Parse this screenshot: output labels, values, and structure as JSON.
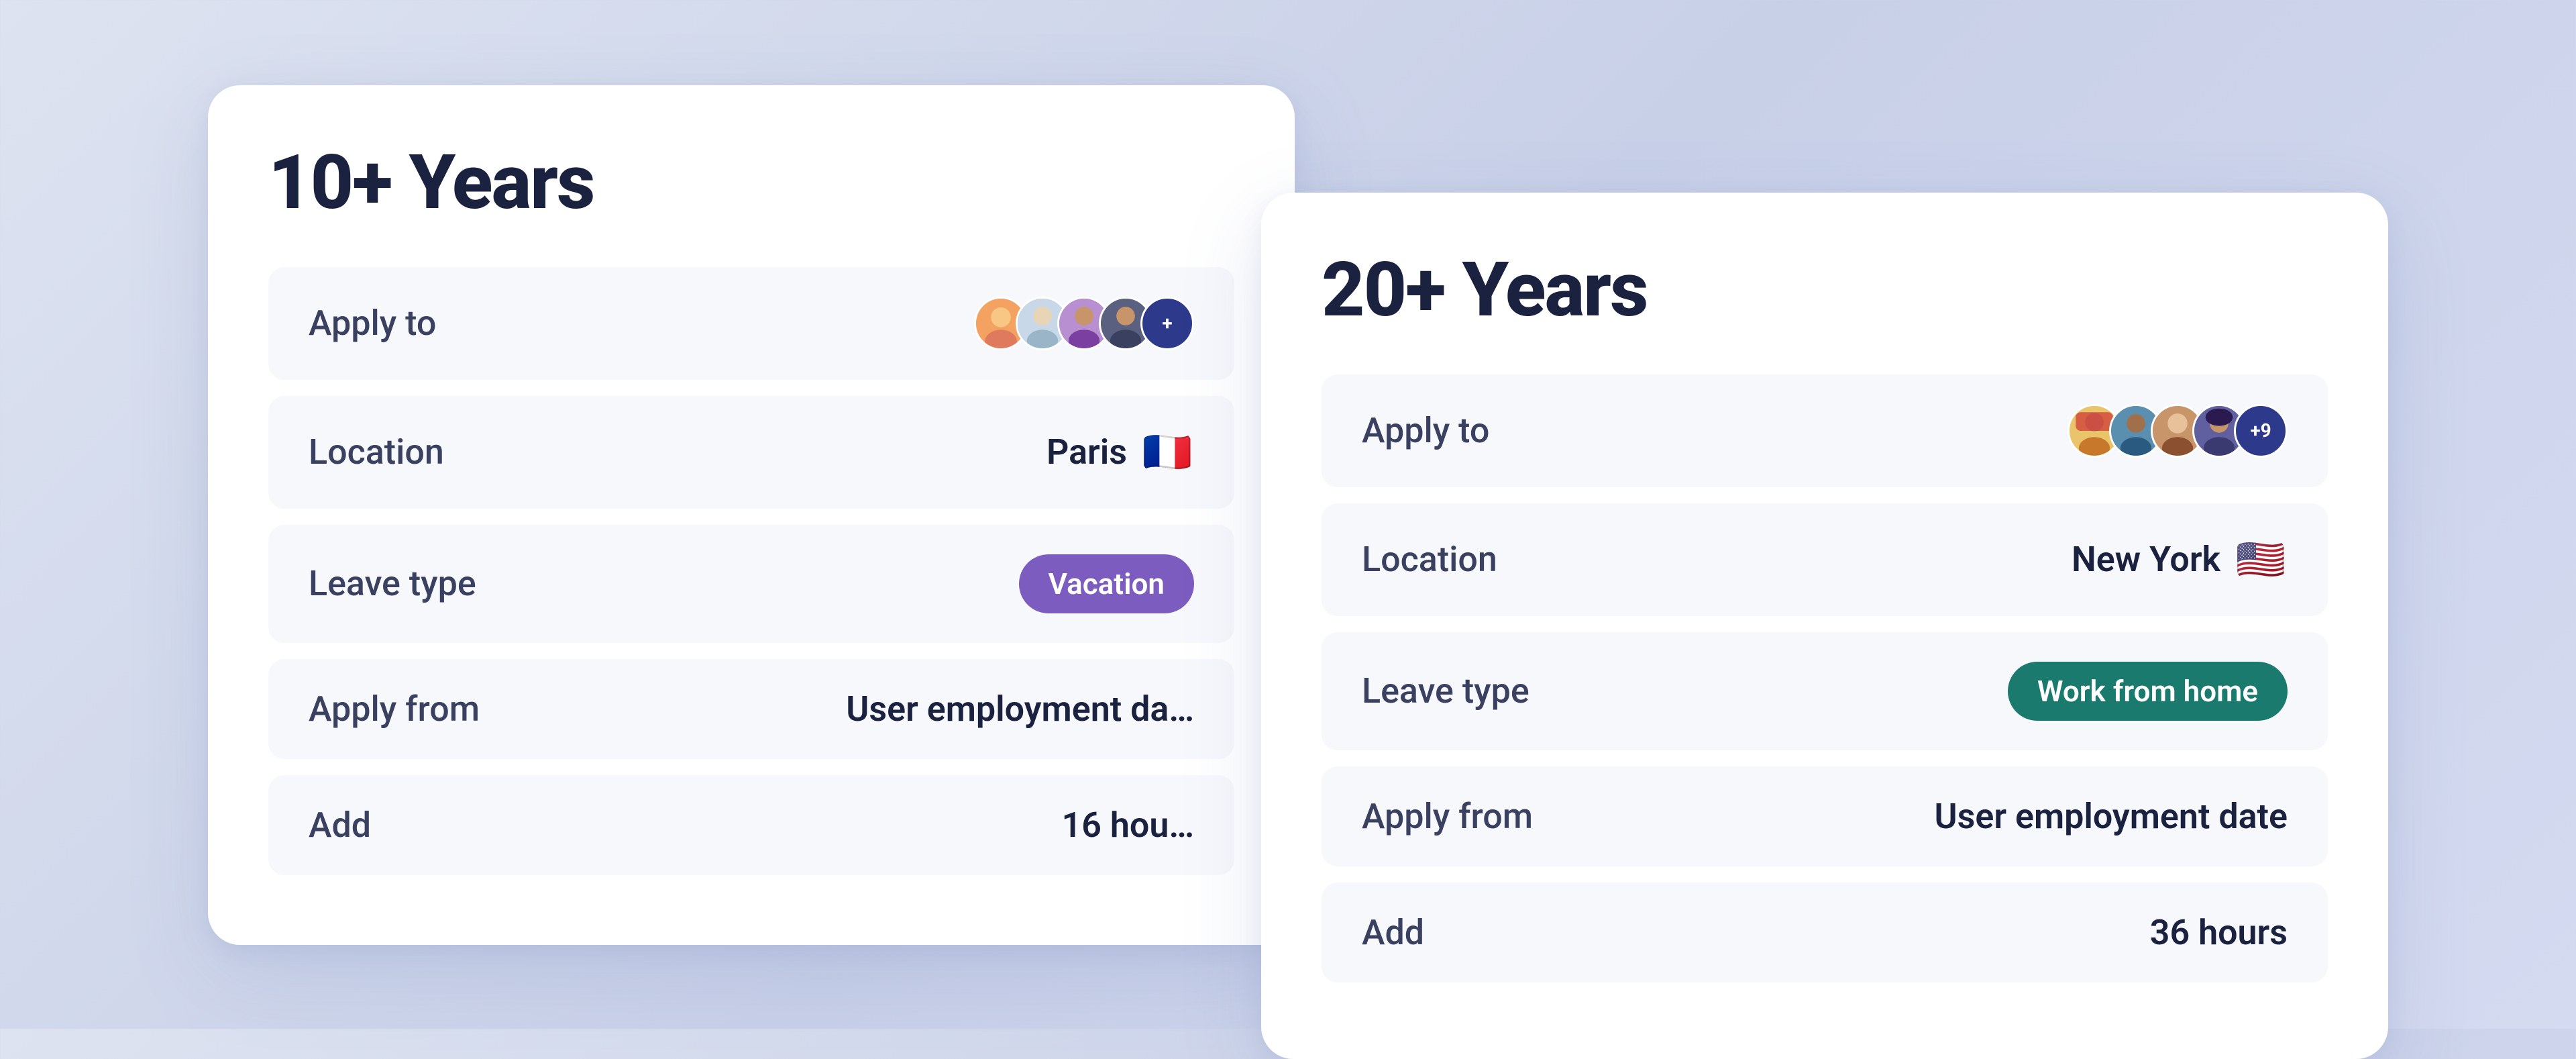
{
  "cards": {
    "back": {
      "title": "10+ Years",
      "fields": [
        {
          "id": "apply-to",
          "label": "Apply to",
          "type": "avatars",
          "avatarCount": "+",
          "avatarColors": [
            "av1",
            "av2",
            "av3",
            "av4"
          ]
        },
        {
          "id": "location",
          "label": "Location",
          "type": "text-flag",
          "value": "Paris",
          "flag": "🇫🇷"
        },
        {
          "id": "leave-type",
          "label": "Leave type",
          "type": "badge",
          "badgeText": "Vacation",
          "badgeClass": "badge-purple"
        },
        {
          "id": "apply-from",
          "label": "Apply from",
          "type": "text",
          "value": "User employment da…"
        },
        {
          "id": "add",
          "label": "Add",
          "type": "text",
          "value": "16 hou…"
        }
      ]
    },
    "front": {
      "title": "20+ Years",
      "fields": [
        {
          "id": "apply-to",
          "label": "Apply to",
          "type": "avatars",
          "avatarCountLabel": "+9",
          "avatarColors": [
            "av5",
            "av6",
            "av7",
            "av8"
          ]
        },
        {
          "id": "location",
          "label": "Location",
          "type": "text-flag",
          "value": "New York",
          "flag": "🇺🇸"
        },
        {
          "id": "leave-type",
          "label": "Leave type",
          "type": "badge",
          "badgeText": "Work from home",
          "badgeClass": "badge-teal"
        },
        {
          "id": "apply-from",
          "label": "Apply from",
          "type": "text",
          "value": "User employment date"
        },
        {
          "id": "add",
          "label": "Add",
          "type": "text",
          "value": "36 hours"
        }
      ]
    }
  },
  "labels": {
    "back_title": "10+ Years",
    "front_title": "20+ Years",
    "apply_to": "Apply to",
    "location": "Location",
    "leave_type": "Leave type",
    "apply_from": "Apply from",
    "add": "Add",
    "back_location": "Paris",
    "back_leave": "Vacation",
    "back_apply_from": "User employment da…",
    "back_add": "16 hou…",
    "back_plus": "+",
    "front_location": "New York",
    "front_leave": "Work from home",
    "front_apply_from": "User employment date",
    "front_add": "36 hours",
    "front_plus": "+9"
  }
}
